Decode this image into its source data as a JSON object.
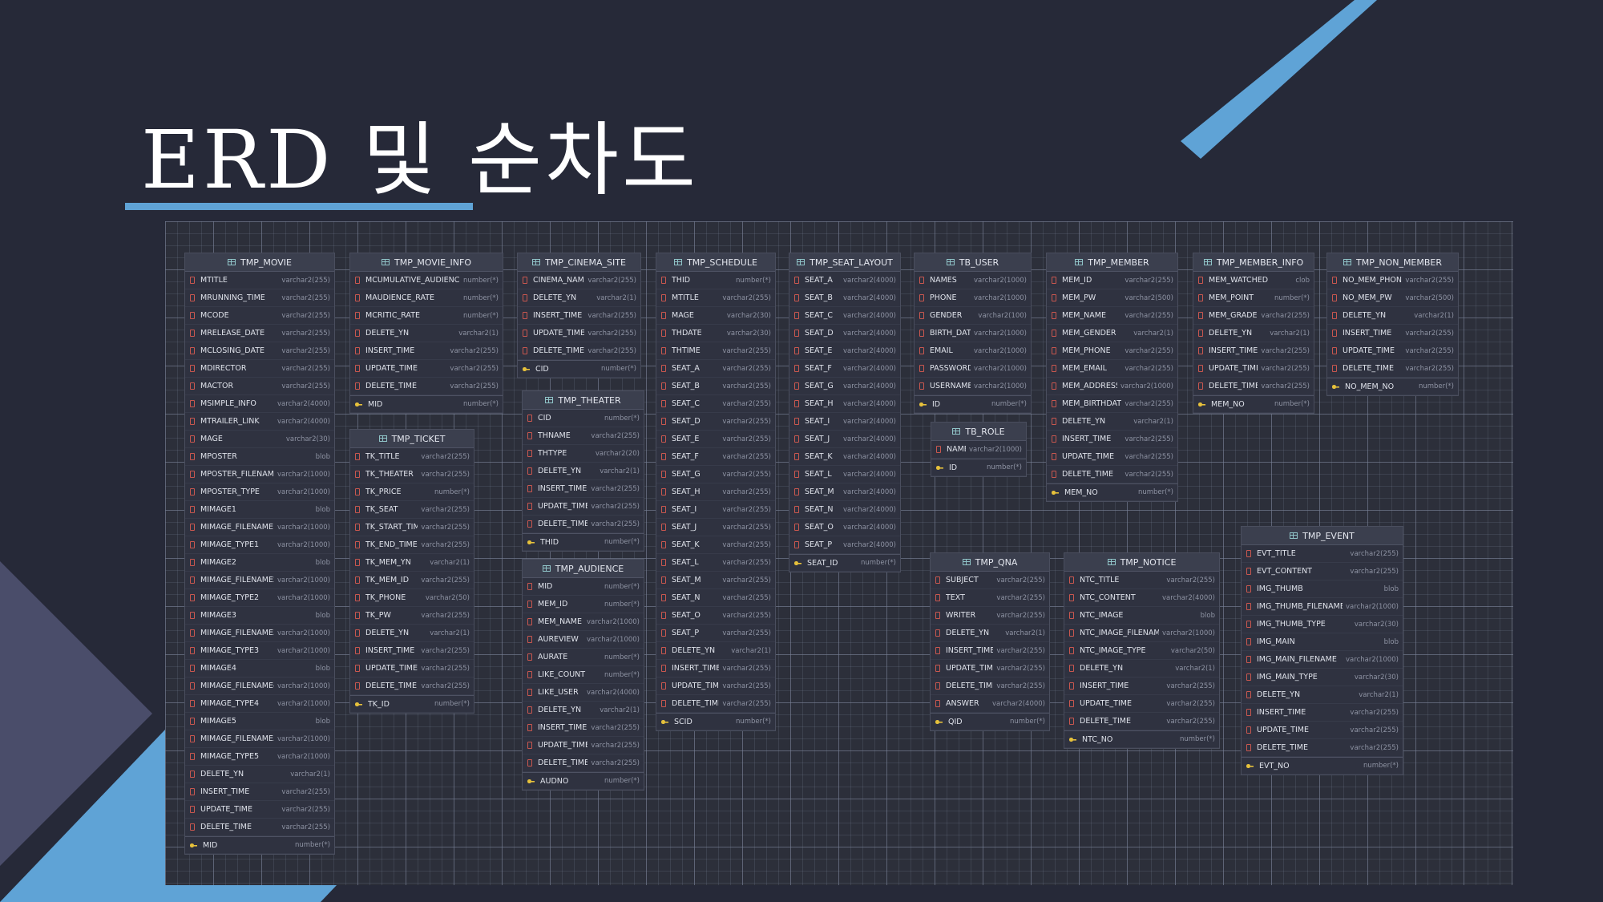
{
  "title": "ERD 및 순차도",
  "colors": {
    "background": "#262938",
    "accent": "#5fa3d6",
    "grid": "#2c2f3a",
    "entity_header": "#3b3f4e"
  },
  "icons": {
    "entity": "table-icon",
    "column": "column-icon",
    "primary_key": "key-icon"
  },
  "entities": [
    {
      "name": "TMP_MOVIE",
      "columns": [
        {
          "name": "MTITLE",
          "type": "varchar2(255)"
        },
        {
          "name": "MRUNNING_TIME",
          "type": "varchar2(255)"
        },
        {
          "name": "MCODE",
          "type": "varchar2(255)"
        },
        {
          "name": "MRELEASE_DATE",
          "type": "varchar2(255)"
        },
        {
          "name": "MCLOSING_DATE",
          "type": "varchar2(255)"
        },
        {
          "name": "MDIRECTOR",
          "type": "varchar2(255)"
        },
        {
          "name": "MACTOR",
          "type": "varchar2(255)"
        },
        {
          "name": "MSIMPLE_INFO",
          "type": "varchar2(4000)"
        },
        {
          "name": "MTRAILER_LINK",
          "type": "varchar2(4000)"
        },
        {
          "name": "MAGE",
          "type": "varchar2(30)"
        },
        {
          "name": "MPOSTER",
          "type": "blob"
        },
        {
          "name": "MPOSTER_FILENAME",
          "type": "varchar2(1000)"
        },
        {
          "name": "MPOSTER_TYPE",
          "type": "varchar2(1000)"
        },
        {
          "name": "MIMAGE1",
          "type": "blob"
        },
        {
          "name": "MIMAGE_FILENAME1",
          "type": "varchar2(1000)"
        },
        {
          "name": "MIMAGE_TYPE1",
          "type": "varchar2(1000)"
        },
        {
          "name": "MIMAGE2",
          "type": "blob"
        },
        {
          "name": "MIMAGE_FILENAME2",
          "type": "varchar2(1000)"
        },
        {
          "name": "MIMAGE_TYPE2",
          "type": "varchar2(1000)"
        },
        {
          "name": "MIMAGE3",
          "type": "blob"
        },
        {
          "name": "MIMAGE_FILENAME3",
          "type": "varchar2(1000)"
        },
        {
          "name": "MIMAGE_TYPE3",
          "type": "varchar2(1000)"
        },
        {
          "name": "MIMAGE4",
          "type": "blob"
        },
        {
          "name": "MIMAGE_FILENAME4",
          "type": "varchar2(1000)"
        },
        {
          "name": "MIMAGE_TYPE4",
          "type": "varchar2(1000)"
        },
        {
          "name": "MIMAGE5",
          "type": "blob"
        },
        {
          "name": "MIMAGE_FILENAME5",
          "type": "varchar2(1000)"
        },
        {
          "name": "MIMAGE_TYPE5",
          "type": "varchar2(1000)"
        },
        {
          "name": "DELETE_YN",
          "type": "varchar2(1)"
        },
        {
          "name": "INSERT_TIME",
          "type": "varchar2(255)"
        },
        {
          "name": "UPDATE_TIME",
          "type": "varchar2(255)"
        },
        {
          "name": "DELETE_TIME",
          "type": "varchar2(255)"
        },
        {
          "name": "MID",
          "type": "number(*)",
          "pk": true
        }
      ]
    },
    {
      "name": "TMP_MOVIE_INFO",
      "columns": [
        {
          "name": "MCUMULATIVE_AUDIENCE",
          "type": "number(*)"
        },
        {
          "name": "MAUDIENCE_RATE",
          "type": "number(*)"
        },
        {
          "name": "MCRITIC_RATE",
          "type": "number(*)"
        },
        {
          "name": "DELETE_YN",
          "type": "varchar2(1)"
        },
        {
          "name": "INSERT_TIME",
          "type": "varchar2(255)"
        },
        {
          "name": "UPDATE_TIME",
          "type": "varchar2(255)"
        },
        {
          "name": "DELETE_TIME",
          "type": "varchar2(255)"
        },
        {
          "name": "MID",
          "type": "number(*)",
          "pk": true
        }
      ]
    },
    {
      "name": "TMP_TICKET",
      "columns": [
        {
          "name": "TK_TITLE",
          "type": "varchar2(255)"
        },
        {
          "name": "TK_THEATER",
          "type": "varchar2(255)"
        },
        {
          "name": "TK_PRICE",
          "type": "number(*)"
        },
        {
          "name": "TK_SEAT",
          "type": "varchar2(255)"
        },
        {
          "name": "TK_START_TIME",
          "type": "varchar2(255)"
        },
        {
          "name": "TK_END_TIME",
          "type": "varchar2(255)"
        },
        {
          "name": "TK_MEM_YN",
          "type": "varchar2(1)"
        },
        {
          "name": "TK_MEM_ID",
          "type": "varchar2(255)"
        },
        {
          "name": "TK_PHONE",
          "type": "varchar2(50)"
        },
        {
          "name": "TK_PW",
          "type": "varchar2(255)"
        },
        {
          "name": "DELETE_YN",
          "type": "varchar2(1)"
        },
        {
          "name": "INSERT_TIME",
          "type": "varchar2(255)"
        },
        {
          "name": "UPDATE_TIME",
          "type": "varchar2(255)"
        },
        {
          "name": "DELETE_TIME",
          "type": "varchar2(255)"
        },
        {
          "name": "TK_ID",
          "type": "number(*)",
          "pk": true
        }
      ]
    },
    {
      "name": "TMP_CINEMA_SITE",
      "columns": [
        {
          "name": "CINEMA_NAME",
          "type": "varchar2(255)"
        },
        {
          "name": "DELETE_YN",
          "type": "varchar2(1)"
        },
        {
          "name": "INSERT_TIME",
          "type": "varchar2(255)"
        },
        {
          "name": "UPDATE_TIME",
          "type": "varchar2(255)"
        },
        {
          "name": "DELETE_TIME",
          "type": "varchar2(255)"
        },
        {
          "name": "CID",
          "type": "number(*)",
          "pk": true
        }
      ]
    },
    {
      "name": "TMP_THEATER",
      "columns": [
        {
          "name": "CID",
          "type": "number(*)"
        },
        {
          "name": "THNAME",
          "type": "varchar2(255)"
        },
        {
          "name": "THTYPE",
          "type": "varchar2(20)"
        },
        {
          "name": "DELETE_YN",
          "type": "varchar2(1)"
        },
        {
          "name": "INSERT_TIME",
          "type": "varchar2(255)"
        },
        {
          "name": "UPDATE_TIME",
          "type": "varchar2(255)"
        },
        {
          "name": "DELETE_TIME",
          "type": "varchar2(255)"
        },
        {
          "name": "THID",
          "type": "number(*)",
          "pk": true
        }
      ]
    },
    {
      "name": "TMP_AUDIENCE",
      "columns": [
        {
          "name": "MID",
          "type": "number(*)"
        },
        {
          "name": "MEM_ID",
          "type": "number(*)"
        },
        {
          "name": "MEM_NAME",
          "type": "varchar2(1000)"
        },
        {
          "name": "AUREVIEW",
          "type": "varchar2(1000)"
        },
        {
          "name": "AURATE",
          "type": "number(*)"
        },
        {
          "name": "LIKE_COUNT",
          "type": "number(*)"
        },
        {
          "name": "LIKE_USER",
          "type": "varchar2(4000)"
        },
        {
          "name": "DELETE_YN",
          "type": "varchar2(1)"
        },
        {
          "name": "INSERT_TIME",
          "type": "varchar2(255)"
        },
        {
          "name": "UPDATE_TIME",
          "type": "varchar2(255)"
        },
        {
          "name": "DELETE_TIME",
          "type": "varchar2(255)"
        },
        {
          "name": "AUDNO",
          "type": "number(*)",
          "pk": true
        }
      ]
    },
    {
      "name": "TMP_SCHEDULE",
      "columns": [
        {
          "name": "THID",
          "type": "number(*)"
        },
        {
          "name": "MTITLE",
          "type": "varchar2(255)"
        },
        {
          "name": "MAGE",
          "type": "varchar2(30)"
        },
        {
          "name": "THDATE",
          "type": "varchar2(30)"
        },
        {
          "name": "THTIME",
          "type": "varchar2(255)"
        },
        {
          "name": "SEAT_A",
          "type": "varchar2(255)"
        },
        {
          "name": "SEAT_B",
          "type": "varchar2(255)"
        },
        {
          "name": "SEAT_C",
          "type": "varchar2(255)"
        },
        {
          "name": "SEAT_D",
          "type": "varchar2(255)"
        },
        {
          "name": "SEAT_E",
          "type": "varchar2(255)"
        },
        {
          "name": "SEAT_F",
          "type": "varchar2(255)"
        },
        {
          "name": "SEAT_G",
          "type": "varchar2(255)"
        },
        {
          "name": "SEAT_H",
          "type": "varchar2(255)"
        },
        {
          "name": "SEAT_I",
          "type": "varchar2(255)"
        },
        {
          "name": "SEAT_J",
          "type": "varchar2(255)"
        },
        {
          "name": "SEAT_K",
          "type": "varchar2(255)"
        },
        {
          "name": "SEAT_L",
          "type": "varchar2(255)"
        },
        {
          "name": "SEAT_M",
          "type": "varchar2(255)"
        },
        {
          "name": "SEAT_N",
          "type": "varchar2(255)"
        },
        {
          "name": "SEAT_O",
          "type": "varchar2(255)"
        },
        {
          "name": "SEAT_P",
          "type": "varchar2(255)"
        },
        {
          "name": "DELETE_YN",
          "type": "varchar2(1)"
        },
        {
          "name": "INSERT_TIME",
          "type": "varchar2(255)"
        },
        {
          "name": "UPDATE_TIME",
          "type": "varchar2(255)"
        },
        {
          "name": "DELETE_TIME",
          "type": "varchar2(255)"
        },
        {
          "name": "SCID",
          "type": "number(*)",
          "pk": true
        }
      ]
    },
    {
      "name": "TMP_SEAT_LAYOUT",
      "columns": [
        {
          "name": "SEAT_A",
          "type": "varchar2(4000)"
        },
        {
          "name": "SEAT_B",
          "type": "varchar2(4000)"
        },
        {
          "name": "SEAT_C",
          "type": "varchar2(4000)"
        },
        {
          "name": "SEAT_D",
          "type": "varchar2(4000)"
        },
        {
          "name": "SEAT_E",
          "type": "varchar2(4000)"
        },
        {
          "name": "SEAT_F",
          "type": "varchar2(4000)"
        },
        {
          "name": "SEAT_G",
          "type": "varchar2(4000)"
        },
        {
          "name": "SEAT_H",
          "type": "varchar2(4000)"
        },
        {
          "name": "SEAT_I",
          "type": "varchar2(4000)"
        },
        {
          "name": "SEAT_J",
          "type": "varchar2(4000)"
        },
        {
          "name": "SEAT_K",
          "type": "varchar2(4000)"
        },
        {
          "name": "SEAT_L",
          "type": "varchar2(4000)"
        },
        {
          "name": "SEAT_M",
          "type": "varchar2(4000)"
        },
        {
          "name": "SEAT_N",
          "type": "varchar2(4000)"
        },
        {
          "name": "SEAT_O",
          "type": "varchar2(4000)"
        },
        {
          "name": "SEAT_P",
          "type": "varchar2(4000)"
        },
        {
          "name": "SEAT_ID",
          "type": "number(*)",
          "pk": true
        }
      ]
    },
    {
      "name": "TB_USER",
      "columns": [
        {
          "name": "NAMES",
          "type": "varchar2(1000)"
        },
        {
          "name": "PHONE",
          "type": "varchar2(1000)"
        },
        {
          "name": "GENDER",
          "type": "varchar2(100)"
        },
        {
          "name": "BIRTH_DATE",
          "type": "varchar2(1000)"
        },
        {
          "name": "EMAIL",
          "type": "varchar2(1000)"
        },
        {
          "name": "PASSWORD",
          "type": "varchar2(1000)"
        },
        {
          "name": "USERNAME",
          "type": "varchar2(1000)"
        },
        {
          "name": "ID",
          "type": "number(*)",
          "pk": true
        }
      ]
    },
    {
      "name": "TB_ROLE",
      "columns": [
        {
          "name": "NAME",
          "type": "varchar2(1000)"
        },
        {
          "name": "ID",
          "type": "number(*)",
          "pk": true
        }
      ]
    },
    {
      "name": "TMP_MEMBER",
      "columns": [
        {
          "name": "MEM_ID",
          "type": "varchar2(255)"
        },
        {
          "name": "MEM_PW",
          "type": "varchar2(500)"
        },
        {
          "name": "MEM_NAME",
          "type": "varchar2(255)"
        },
        {
          "name": "MEM_GENDER",
          "type": "varchar2(1)"
        },
        {
          "name": "MEM_PHONE",
          "type": "varchar2(255)"
        },
        {
          "name": "MEM_EMAIL",
          "type": "varchar2(255)"
        },
        {
          "name": "MEM_ADDRESS",
          "type": "varchar2(1000)"
        },
        {
          "name": "MEM_BIRTHDATE",
          "type": "varchar2(255)"
        },
        {
          "name": "DELETE_YN",
          "type": "varchar2(1)"
        },
        {
          "name": "INSERT_TIME",
          "type": "varchar2(255)"
        },
        {
          "name": "UPDATE_TIME",
          "type": "varchar2(255)"
        },
        {
          "name": "DELETE_TIME",
          "type": "varchar2(255)"
        },
        {
          "name": "MEM_NO",
          "type": "number(*)",
          "pk": true
        }
      ]
    },
    {
      "name": "TMP_MEMBER_INFO",
      "columns": [
        {
          "name": "MEM_WATCHED",
          "type": "clob"
        },
        {
          "name": "MEM_POINT",
          "type": "number(*)"
        },
        {
          "name": "MEM_GRADE",
          "type": "varchar2(255)"
        },
        {
          "name": "DELETE_YN",
          "type": "varchar2(1)"
        },
        {
          "name": "INSERT_TIME",
          "type": "varchar2(255)"
        },
        {
          "name": "UPDATE_TIME",
          "type": "varchar2(255)"
        },
        {
          "name": "DELETE_TIME",
          "type": "varchar2(255)"
        },
        {
          "name": "MEM_NO",
          "type": "number(*)",
          "pk": true
        }
      ]
    },
    {
      "name": "TMP_NON_MEMBER",
      "columns": [
        {
          "name": "NO_MEM_PHONE",
          "type": "varchar2(255)"
        },
        {
          "name": "NO_MEM_PW",
          "type": "varchar2(500)"
        },
        {
          "name": "DELETE_YN",
          "type": "varchar2(1)"
        },
        {
          "name": "INSERT_TIME",
          "type": "varchar2(255)"
        },
        {
          "name": "UPDATE_TIME",
          "type": "varchar2(255)"
        },
        {
          "name": "DELETE_TIME",
          "type": "varchar2(255)"
        },
        {
          "name": "NO_MEM_NO",
          "type": "number(*)",
          "pk": true
        }
      ]
    },
    {
      "name": "TMP_QNA",
      "columns": [
        {
          "name": "SUBJECT",
          "type": "varchar2(255)"
        },
        {
          "name": "TEXT",
          "type": "varchar2(255)"
        },
        {
          "name": "WRITER",
          "type": "varchar2(255)"
        },
        {
          "name": "DELETE_YN",
          "type": "varchar2(1)"
        },
        {
          "name": "INSERT_TIME",
          "type": "varchar2(255)"
        },
        {
          "name": "UPDATE_TIME",
          "type": "varchar2(255)"
        },
        {
          "name": "DELETE_TIME",
          "type": "varchar2(255)"
        },
        {
          "name": "ANSWER",
          "type": "varchar2(4000)"
        },
        {
          "name": "QID",
          "type": "number(*)",
          "pk": true
        }
      ]
    },
    {
      "name": "TMP_NOTICE",
      "columns": [
        {
          "name": "NTC_TITLE",
          "type": "varchar2(255)"
        },
        {
          "name": "NTC_CONTENT",
          "type": "varchar2(4000)"
        },
        {
          "name": "NTC_IMAGE",
          "type": "blob"
        },
        {
          "name": "NTC_IMAGE_FILENAME",
          "type": "varchar2(1000)"
        },
        {
          "name": "NTC_IMAGE_TYPE",
          "type": "varchar2(50)"
        },
        {
          "name": "DELETE_YN",
          "type": "varchar2(1)"
        },
        {
          "name": "INSERT_TIME",
          "type": "varchar2(255)"
        },
        {
          "name": "UPDATE_TIME",
          "type": "varchar2(255)"
        },
        {
          "name": "DELETE_TIME",
          "type": "varchar2(255)"
        },
        {
          "name": "NTC_NO",
          "type": "number(*)",
          "pk": true
        }
      ]
    },
    {
      "name": "TMP_EVENT",
      "columns": [
        {
          "name": "EVT_TITLE",
          "type": "varchar2(255)"
        },
        {
          "name": "EVT_CONTENT",
          "type": "varchar2(255)"
        },
        {
          "name": "IMG_THUMB",
          "type": "blob"
        },
        {
          "name": "IMG_THUMB_FILENAME",
          "type": "varchar2(1000)"
        },
        {
          "name": "IMG_THUMB_TYPE",
          "type": "varchar2(30)"
        },
        {
          "name": "IMG_MAIN",
          "type": "blob"
        },
        {
          "name": "IMG_MAIN_FILENAME",
          "type": "varchar2(1000)"
        },
        {
          "name": "IMG_MAIN_TYPE",
          "type": "varchar2(30)"
        },
        {
          "name": "DELETE_YN",
          "type": "varchar2(1)"
        },
        {
          "name": "INSERT_TIME",
          "type": "varchar2(255)"
        },
        {
          "name": "UPDATE_TIME",
          "type": "varchar2(255)"
        },
        {
          "name": "DELETE_TIME",
          "type": "varchar2(255)"
        },
        {
          "name": "EVT_NO",
          "type": "number(*)",
          "pk": true
        }
      ]
    }
  ]
}
